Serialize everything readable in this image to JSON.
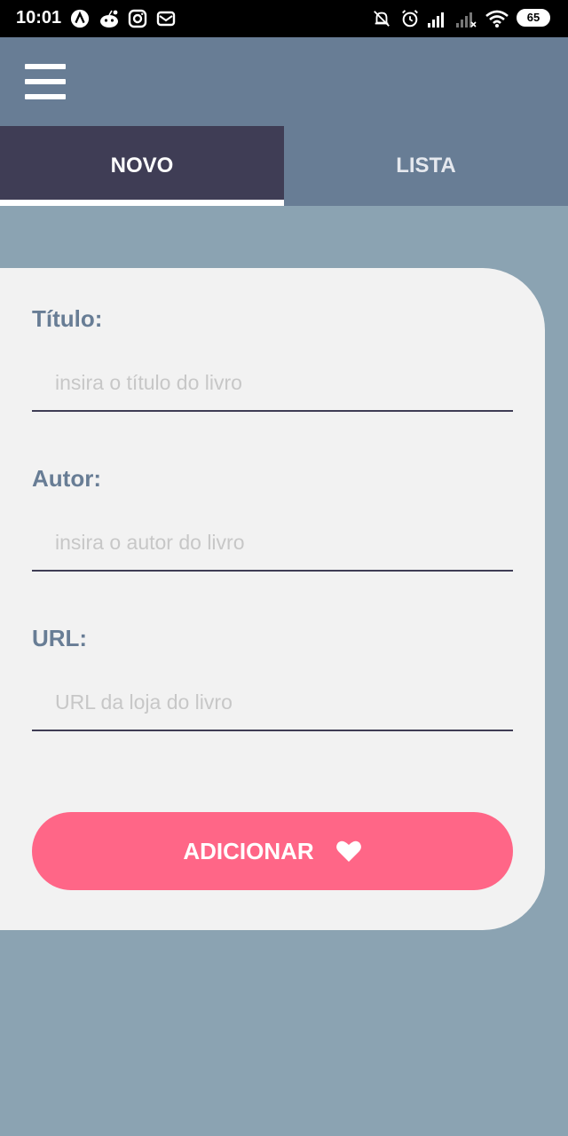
{
  "status_bar": {
    "time": "10:01",
    "battery": "65"
  },
  "tabs": [
    {
      "label": "NOVO",
      "active": true
    },
    {
      "label": "LISTA",
      "active": false
    }
  ],
  "form": {
    "titulo": {
      "label": "Título:",
      "placeholder": "insira o título do livro",
      "value": ""
    },
    "autor": {
      "label": "Autor:",
      "placeholder": "insira o autor do livro",
      "value": ""
    },
    "url": {
      "label": "URL:",
      "placeholder": "URL da loja do livro",
      "value": ""
    },
    "submit_label": "ADICIONAR"
  },
  "colors": {
    "appbar": "#687d95",
    "active_tab": "#3f3d55",
    "background": "#8ba3b2",
    "card": "#f2f2f2",
    "accent_button": "#ff6687",
    "label": "#687d95"
  },
  "icons": [
    "menu-icon",
    "heart-icon",
    "navigation-app-icon",
    "reddit-icon",
    "instagram-icon",
    "mail-icon",
    "mute-icon",
    "alarm-icon",
    "signal-icon",
    "wifi-icon",
    "battery-icon"
  ]
}
